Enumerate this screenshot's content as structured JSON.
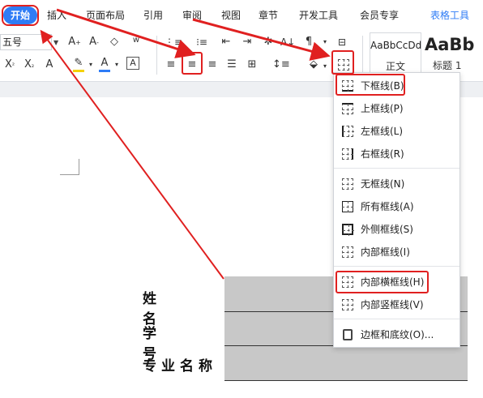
{
  "tabs": [
    {
      "label": "开始",
      "active": true
    },
    {
      "label": "插入"
    },
    {
      "label": "页面布局"
    },
    {
      "label": "引用"
    },
    {
      "label": "审阅"
    },
    {
      "label": "视图"
    },
    {
      "label": "章节"
    },
    {
      "label": "开发工具"
    },
    {
      "label": "会员专享"
    },
    {
      "label": "表格工具",
      "accent": true
    }
  ],
  "ribbon": {
    "font_size": "五号",
    "styles": [
      {
        "sample": "AaBbCcDd",
        "name": "正文"
      },
      {
        "sample": "AaBb",
        "name": "标题 1"
      }
    ]
  },
  "menu": {
    "items": [
      {
        "label": "下框线(B)",
        "icon": "bottom-border-icon"
      },
      {
        "label": "上框线(P)",
        "icon": "top-border-icon"
      },
      {
        "label": "左框线(L)",
        "icon": "left-border-icon"
      },
      {
        "label": "右框线(R)",
        "icon": "right-border-icon"
      },
      {
        "label": "无框线(N)",
        "icon": "no-border-icon"
      },
      {
        "label": "所有框线(A)",
        "icon": "all-borders-icon"
      },
      {
        "label": "外侧框线(S)",
        "icon": "outside-borders-icon"
      },
      {
        "label": "内部框线(I)",
        "icon": "inside-borders-icon"
      },
      {
        "label": "内部横框线(H)",
        "icon": "inside-horizontal-border-icon"
      },
      {
        "label": "内部竖框线(V)",
        "icon": "inside-vertical-border-icon"
      },
      {
        "label": "边框和底纹(O)...",
        "icon": "borders-shading-icon"
      }
    ]
  },
  "document": {
    "rows": [
      {
        "label": "姓 名"
      },
      {
        "label": "学 号"
      },
      {
        "label": "专业名称"
      }
    ]
  },
  "colors": {
    "accent": "#2e7cf6",
    "highlight": "#e02020",
    "table_fill": "#c8c8c8"
  }
}
